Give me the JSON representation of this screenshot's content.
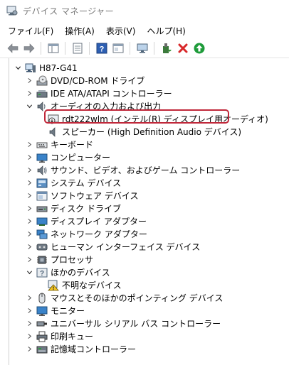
{
  "window": {
    "title": "デバイス マネージャー"
  },
  "menu": [
    {
      "label": "ファイル(F)"
    },
    {
      "label": "操作(A)"
    },
    {
      "label": "表示(V)"
    },
    {
      "label": "ヘルプ(H)"
    }
  ],
  "toolbar": [
    {
      "icon": "back-arrow-icon"
    },
    {
      "icon": "forward-arrow-icon"
    },
    {
      "icon": "properties-pane-icon"
    },
    {
      "icon": "sheet-icon"
    },
    {
      "icon": "help-icon"
    },
    {
      "icon": "pane-icon"
    },
    {
      "icon": "monitor-scan-icon"
    },
    {
      "icon": "update-driver-icon"
    },
    {
      "icon": "uninstall-x-icon"
    },
    {
      "icon": "enable-device-icon"
    }
  ],
  "tree": {
    "root": "H87-G41",
    "items": [
      {
        "label": "DVD/CD-ROM ドライブ",
        "icon": "dvd-drive-icon"
      },
      {
        "label": "IDE ATA/ATAPI コントローラー",
        "icon": "ide-controller-icon"
      },
      {
        "label": "オーディオの入力および出力",
        "icon": "audio-speaker-icon",
        "expanded": true
      },
      {
        "label": "rdt222wlm (インテル(R) ディスプレイ用オーディオ)",
        "icon": "monitor-audio-warning-icon",
        "highlighted": true
      },
      {
        "label": "スピーカー (High Definition Audio デバイス)",
        "icon": "speaker-icon"
      },
      {
        "label": "キーボード",
        "icon": "keyboard-icon"
      },
      {
        "label": "コンピューター",
        "icon": "computer-icon"
      },
      {
        "label": "サウンド、ビデオ、およびゲーム コントローラー",
        "icon": "sound-icon"
      },
      {
        "label": "システム デバイス",
        "icon": "system-devices-icon"
      },
      {
        "label": "ソフトウェア デバイス",
        "icon": "software-devices-icon"
      },
      {
        "label": "ディスク ドライブ",
        "icon": "disk-drive-icon"
      },
      {
        "label": "ディスプレイ アダプター",
        "icon": "display-adapter-icon"
      },
      {
        "label": "ネットワーク アダプター",
        "icon": "network-adapter-icon"
      },
      {
        "label": "ヒューマン インターフェイス デバイス",
        "icon": "hid-icon"
      },
      {
        "label": "プロセッサ",
        "icon": "processor-icon"
      },
      {
        "label": "ほかのデバイス",
        "icon": "other-devices-icon",
        "expanded": true
      },
      {
        "label": "不明なデバイス",
        "icon": "unknown-device-warning-icon"
      },
      {
        "label": "マウスとそのほかのポインティング デバイス",
        "icon": "mouse-icon"
      },
      {
        "label": "モニター",
        "icon": "monitor-icon"
      },
      {
        "label": "ユニバーサル シリアル バス コントローラー",
        "icon": "usb-icon"
      },
      {
        "label": "印刷キュー",
        "icon": "printer-icon"
      },
      {
        "label": "記憶域コントローラー",
        "icon": "storage-controller-icon"
      }
    ]
  },
  "colors": {
    "highlight_border": "#c0283a",
    "enable_green": "#1e9b3a",
    "uninstall_red": "#d8282a"
  }
}
